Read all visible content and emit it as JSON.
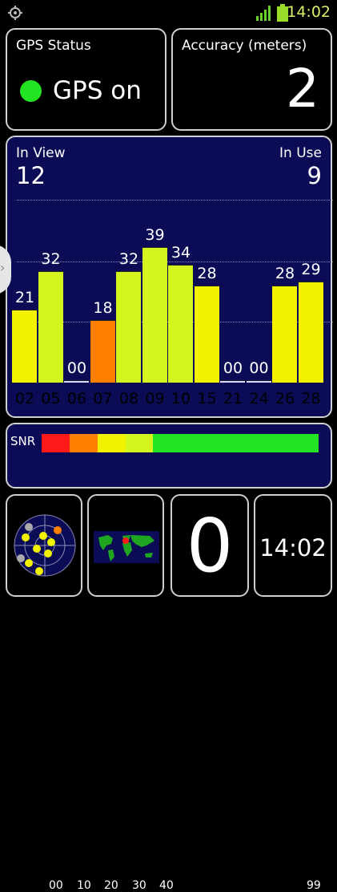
{
  "statusbar": {
    "time": "14:02",
    "icons": [
      "gps-icon",
      "signal-icon",
      "battery-icon"
    ]
  },
  "gps_status": {
    "title": "GPS Status",
    "state": "GPS on",
    "indicator_color": "#22e422"
  },
  "accuracy": {
    "title": "Accuracy (meters)",
    "value": "2"
  },
  "satellites": {
    "in_view_label": "In View",
    "in_view": "12",
    "in_use_label": "In Use",
    "in_use": "9",
    "bars": [
      {
        "prn": "02",
        "snr": 21,
        "label": "21",
        "color": "#f2f200"
      },
      {
        "prn": "05",
        "snr": 32,
        "label": "32",
        "color": "#d4f51e"
      },
      {
        "prn": "06",
        "snr": 0,
        "label": "00",
        "color": "#ff1a1a"
      },
      {
        "prn": "07",
        "snr": 18,
        "label": "18",
        "color": "#ff8000"
      },
      {
        "prn": "08",
        "snr": 32,
        "label": "32",
        "color": "#d4f51e"
      },
      {
        "prn": "09",
        "snr": 39,
        "label": "39",
        "color": "#d4f51e"
      },
      {
        "prn": "10",
        "snr": 34,
        "label": "34",
        "color": "#d4f51e"
      },
      {
        "prn": "15",
        "snr": 28,
        "label": "28",
        "color": "#f2f200"
      },
      {
        "prn": "21",
        "snr": 0,
        "label": "00",
        "color": "#ff1a1a"
      },
      {
        "prn": "24",
        "snr": 0,
        "label": "00",
        "color": "#ff1a1a"
      },
      {
        "prn": "26",
        "snr": 28,
        "label": "28",
        "color": "#f2f200"
      },
      {
        "prn": "28",
        "snr": 29,
        "label": "29",
        "color": "#f2f200"
      }
    ],
    "snr_max": 50
  },
  "snr_legend": {
    "title": "SNR",
    "ticks": [
      "00",
      "10",
      "20",
      "30",
      "40",
      "99"
    ],
    "segments": [
      {
        "color": "#ff1a1a"
      },
      {
        "color": "#ff8000"
      },
      {
        "color": "#f2f200"
      },
      {
        "color": "#d4f51e"
      },
      {
        "color": "#22e422"
      }
    ]
  },
  "bottom": {
    "fix_count": "0",
    "time": "14:02",
    "radar_icon": "sky-radar-icon",
    "map_icon": "world-map-icon"
  }
}
